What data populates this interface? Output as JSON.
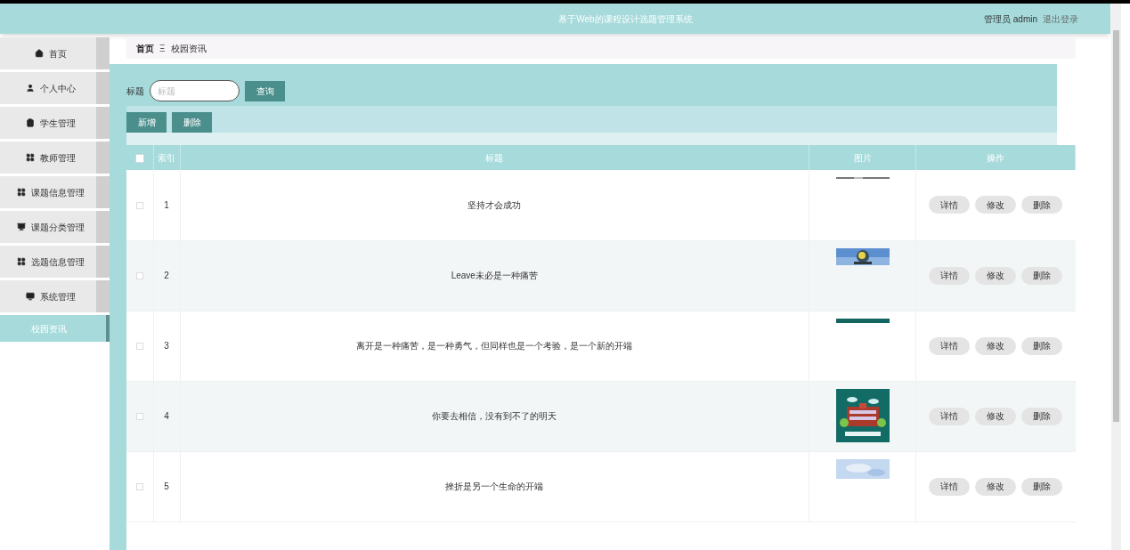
{
  "header": {
    "title": "基于Web的课程设计选题管理系统",
    "role": "管理员 admin",
    "logout": "退出登录"
  },
  "sidebar": {
    "items": [
      {
        "label": "首页",
        "selected": false
      },
      {
        "label": "个人中心",
        "selected": false
      },
      {
        "label": "学生管理",
        "selected": false
      },
      {
        "label": "教师管理",
        "selected": false
      },
      {
        "label": "课题信息管理",
        "selected": false
      },
      {
        "label": "课题分类管理",
        "selected": false
      },
      {
        "label": "选题信息管理",
        "selected": false
      },
      {
        "label": "系统管理",
        "selected": false
      },
      {
        "label": "校园资讯",
        "selected": true
      }
    ]
  },
  "breadcrumb": {
    "home": "首页",
    "separator": "Ξ",
    "current": "校园资讯"
  },
  "search": {
    "label": "标题",
    "placeholder": "标题",
    "button": "查询"
  },
  "toolbar": {
    "add": "新增",
    "delete": "删除"
  },
  "table": {
    "select_all": {
      "checked": false
    },
    "columns": [
      "索引",
      "标题",
      "图片",
      "操作"
    ],
    "rows": [
      {
        "index": "1",
        "title": "坚持才会成功",
        "checked": false,
        "actions": [
          "详情",
          "修改",
          "删除"
        ]
      },
      {
        "index": "2",
        "title": "Leave未必是一种痛苦",
        "checked": false,
        "actions": [
          "详情",
          "修改",
          "删除"
        ]
      },
      {
        "index": "3",
        "title": "离开是一种痛苦，是一种勇气，但同样也是一个考验，是一个新的开端",
        "checked": false,
        "actions": [
          "详情",
          "修改",
          "删除"
        ]
      },
      {
        "index": "4",
        "title": "你要去相信，没有到不了的明天",
        "checked": false,
        "actions": [
          "详情",
          "修改",
          "删除"
        ]
      },
      {
        "index": "5",
        "title": "挫折是另一个生命的开端",
        "checked": false,
        "actions": [
          "详情",
          "修改",
          "删除"
        ]
      }
    ]
  }
}
